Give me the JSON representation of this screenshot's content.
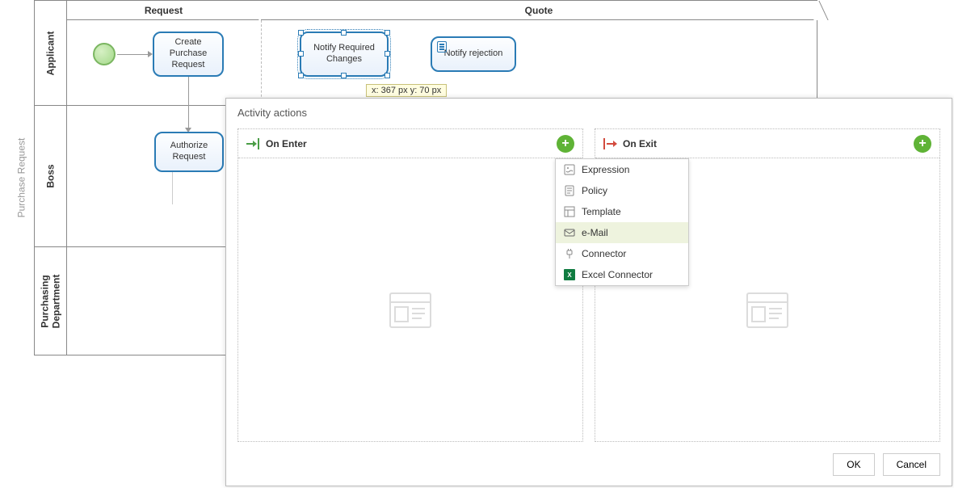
{
  "pool_label": "Purchase Request",
  "lanes": {
    "applicant": "Applicant",
    "boss": "Boss",
    "purchasing": "Purchasing\nDepartment"
  },
  "phases": {
    "request": "Request",
    "quote": "Quote"
  },
  "tasks": {
    "create_purchase_request": "Create\nPurchase\nRequest",
    "notify_required_changes": "Notify Required\nChanges",
    "notify_rejection": "Notify rejection",
    "authorize_request": "Authorize\nRequest"
  },
  "coord_tooltip": "x: 367 px  y: 70 px",
  "dialog": {
    "title": "Activity actions",
    "on_enter_label": "On Enter",
    "on_exit_label": "On Exit",
    "ok": "OK",
    "cancel": "Cancel",
    "menu": {
      "items": [
        {
          "id": "expression",
          "label": "Expression"
        },
        {
          "id": "policy",
          "label": "Policy"
        },
        {
          "id": "template",
          "label": "Template"
        },
        {
          "id": "email",
          "label": "e-Mail"
        },
        {
          "id": "connector",
          "label": "Connector"
        },
        {
          "id": "excel_connector",
          "label": "Excel Connector"
        }
      ],
      "hovered": "email"
    }
  }
}
